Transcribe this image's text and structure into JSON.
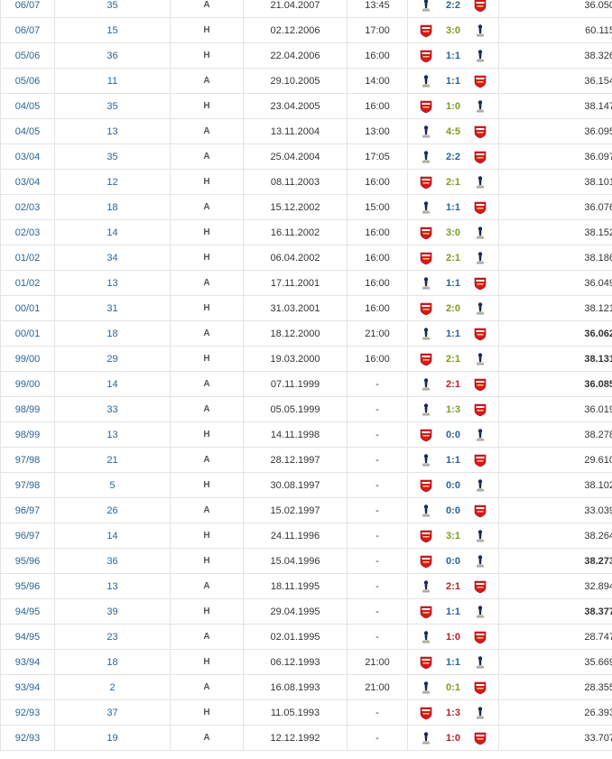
{
  "colors": {
    "draw": "#2a6496",
    "win": "#7a9c1f",
    "loss": "#b3232b",
    "arsenal": "#d8171f",
    "spurs_navy": "#1b2a53"
  },
  "icons": {
    "spurs": "tottenham-crest-icon",
    "arsenal": "arsenal-crest-icon"
  },
  "rows": [
    {
      "season": "06/07",
      "round": "35",
      "venue": "A",
      "date": "21.04.2007",
      "time": "13:45",
      "home": "spurs",
      "away": "arsenal",
      "score": "2:2",
      "result": "draw",
      "attendance": "36.050",
      "bold": false
    },
    {
      "season": "06/07",
      "round": "15",
      "venue": "H",
      "date": "02.12.2006",
      "time": "17:00",
      "home": "arsenal",
      "away": "spurs",
      "score": "3:0",
      "result": "win",
      "attendance": "60.115",
      "bold": false
    },
    {
      "season": "05/06",
      "round": "36",
      "venue": "H",
      "date": "22.04.2006",
      "time": "16:00",
      "home": "arsenal",
      "away": "spurs",
      "score": "1:1",
      "result": "draw",
      "attendance": "38.326",
      "bold": false
    },
    {
      "season": "05/06",
      "round": "11",
      "venue": "A",
      "date": "29.10.2005",
      "time": "14:00",
      "home": "spurs",
      "away": "arsenal",
      "score": "1:1",
      "result": "draw",
      "attendance": "36.154",
      "bold": false
    },
    {
      "season": "04/05",
      "round": "35",
      "venue": "H",
      "date": "23.04.2005",
      "time": "16:00",
      "home": "arsenal",
      "away": "spurs",
      "score": "1:0",
      "result": "win",
      "attendance": "38.147",
      "bold": false
    },
    {
      "season": "04/05",
      "round": "13",
      "venue": "A",
      "date": "13.11.2004",
      "time": "13:00",
      "home": "spurs",
      "away": "arsenal",
      "score": "4:5",
      "result": "win",
      "attendance": "36.095",
      "bold": false
    },
    {
      "season": "03/04",
      "round": "35",
      "venue": "A",
      "date": "25.04.2004",
      "time": "17:05",
      "home": "spurs",
      "away": "arsenal",
      "score": "2:2",
      "result": "draw",
      "attendance": "36.097",
      "bold": false
    },
    {
      "season": "03/04",
      "round": "12",
      "venue": "H",
      "date": "08.11.2003",
      "time": "16:00",
      "home": "arsenal",
      "away": "spurs",
      "score": "2:1",
      "result": "win",
      "attendance": "38.101",
      "bold": false
    },
    {
      "season": "02/03",
      "round": "18",
      "venue": "A",
      "date": "15.12.2002",
      "time": "15:00",
      "home": "spurs",
      "away": "arsenal",
      "score": "1:1",
      "result": "draw",
      "attendance": "36.076",
      "bold": false
    },
    {
      "season": "02/03",
      "round": "14",
      "venue": "H",
      "date": "16.11.2002",
      "time": "16:00",
      "home": "arsenal",
      "away": "spurs",
      "score": "3:0",
      "result": "win",
      "attendance": "38.152",
      "bold": false
    },
    {
      "season": "01/02",
      "round": "34",
      "venue": "H",
      "date": "06.04.2002",
      "time": "16:00",
      "home": "arsenal",
      "away": "spurs",
      "score": "2:1",
      "result": "win",
      "attendance": "38.186",
      "bold": false
    },
    {
      "season": "01/02",
      "round": "13",
      "venue": "A",
      "date": "17.11.2001",
      "time": "16:00",
      "home": "spurs",
      "away": "arsenal",
      "score": "1:1",
      "result": "draw",
      "attendance": "36.049",
      "bold": false
    },
    {
      "season": "00/01",
      "round": "31",
      "venue": "H",
      "date": "31.03.2001",
      "time": "16:00",
      "home": "arsenal",
      "away": "spurs",
      "score": "2:0",
      "result": "win",
      "attendance": "38.121",
      "bold": false
    },
    {
      "season": "00/01",
      "round": "18",
      "venue": "A",
      "date": "18.12.2000",
      "time": "21:00",
      "home": "spurs",
      "away": "arsenal",
      "score": "1:1",
      "result": "draw",
      "attendance": "36.062",
      "bold": true
    },
    {
      "season": "99/00",
      "round": "29",
      "venue": "H",
      "date": "19.03.2000",
      "time": "16:00",
      "home": "arsenal",
      "away": "spurs",
      "score": "2:1",
      "result": "win",
      "attendance": "38.131",
      "bold": true
    },
    {
      "season": "99/00",
      "round": "14",
      "venue": "A",
      "date": "07.11.1999",
      "time": "-",
      "home": "spurs",
      "away": "arsenal",
      "score": "2:1",
      "result": "loss",
      "attendance": "36.085",
      "bold": true
    },
    {
      "season": "98/99",
      "round": "33",
      "venue": "A",
      "date": "05.05.1999",
      "time": "-",
      "home": "spurs",
      "away": "arsenal",
      "score": "1:3",
      "result": "win",
      "attendance": "36.019",
      "bold": false
    },
    {
      "season": "98/99",
      "round": "13",
      "venue": "H",
      "date": "14.11.1998",
      "time": "-",
      "home": "arsenal",
      "away": "spurs",
      "score": "0:0",
      "result": "draw",
      "attendance": "38.278",
      "bold": false
    },
    {
      "season": "97/98",
      "round": "21",
      "venue": "A",
      "date": "28.12.1997",
      "time": "-",
      "home": "spurs",
      "away": "arsenal",
      "score": "1:1",
      "result": "draw",
      "attendance": "29.610",
      "bold": false
    },
    {
      "season": "97/98",
      "round": "5",
      "venue": "H",
      "date": "30.08.1997",
      "time": "-",
      "home": "arsenal",
      "away": "spurs",
      "score": "0:0",
      "result": "draw",
      "attendance": "38.102",
      "bold": false
    },
    {
      "season": "96/97",
      "round": "26",
      "venue": "A",
      "date": "15.02.1997",
      "time": "-",
      "home": "spurs",
      "away": "arsenal",
      "score": "0:0",
      "result": "draw",
      "attendance": "33.039",
      "bold": false
    },
    {
      "season": "96/97",
      "round": "14",
      "venue": "H",
      "date": "24.11.1996",
      "time": "-",
      "home": "arsenal",
      "away": "spurs",
      "score": "3:1",
      "result": "win",
      "attendance": "38.264",
      "bold": false
    },
    {
      "season": "95/96",
      "round": "36",
      "venue": "H",
      "date": "15.04.1996",
      "time": "-",
      "home": "arsenal",
      "away": "spurs",
      "score": "0:0",
      "result": "draw",
      "attendance": "38.273",
      "bold": true
    },
    {
      "season": "95/96",
      "round": "13",
      "venue": "A",
      "date": "18.11.1995",
      "time": "-",
      "home": "spurs",
      "away": "arsenal",
      "score": "2:1",
      "result": "loss",
      "attendance": "32.894",
      "bold": false
    },
    {
      "season": "94/95",
      "round": "39",
      "venue": "H",
      "date": "29.04.1995",
      "time": "-",
      "home": "arsenal",
      "away": "spurs",
      "score": "1:1",
      "result": "draw",
      "attendance": "38.377",
      "bold": true
    },
    {
      "season": "94/95",
      "round": "23",
      "venue": "A",
      "date": "02.01.1995",
      "time": "-",
      "home": "spurs",
      "away": "arsenal",
      "score": "1:0",
      "result": "loss",
      "attendance": "28.747",
      "bold": false
    },
    {
      "season": "93/94",
      "round": "18",
      "venue": "H",
      "date": "06.12.1993",
      "time": "21:00",
      "home": "arsenal",
      "away": "spurs",
      "score": "1:1",
      "result": "draw",
      "attendance": "35.669",
      "bold": false
    },
    {
      "season": "93/94",
      "round": "2",
      "venue": "A",
      "date": "16.08.1993",
      "time": "21:00",
      "home": "spurs",
      "away": "arsenal",
      "score": "0:1",
      "result": "win",
      "attendance": "28.355",
      "bold": false
    },
    {
      "season": "92/93",
      "round": "37",
      "venue": "H",
      "date": "11.05.1993",
      "time": "-",
      "home": "arsenal",
      "away": "spurs",
      "score": "1:3",
      "result": "loss",
      "attendance": "26.393",
      "bold": false
    },
    {
      "season": "92/93",
      "round": "19",
      "venue": "A",
      "date": "12.12.1992",
      "time": "-",
      "home": "spurs",
      "away": "arsenal",
      "score": "1:0",
      "result": "loss",
      "attendance": "33.707",
      "bold": false
    }
  ]
}
